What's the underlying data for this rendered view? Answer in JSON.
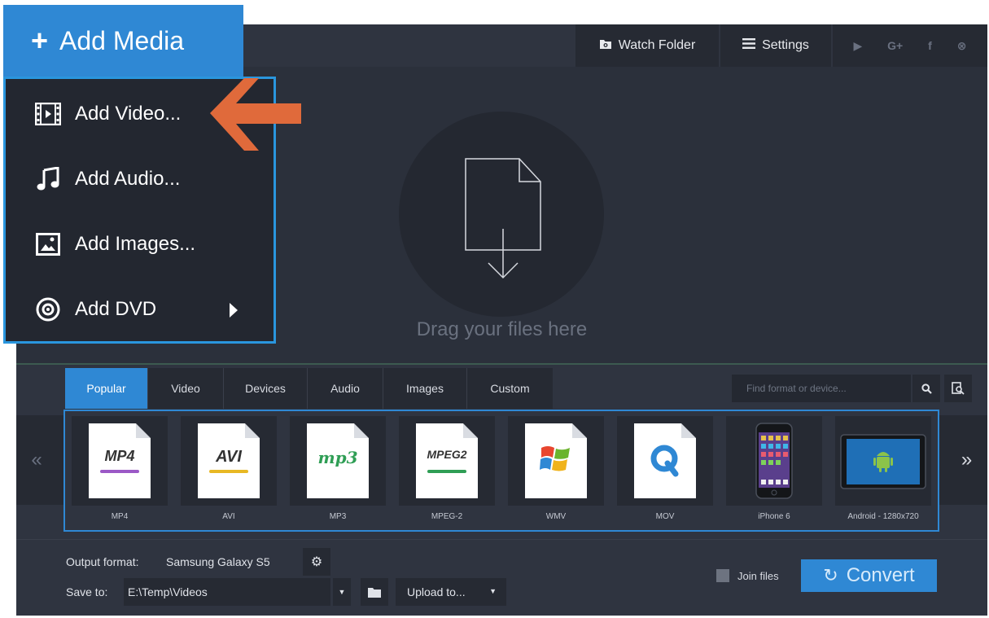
{
  "toolbar": {
    "add_media": "Add Media",
    "watch_folder": "Watch Folder",
    "settings": "Settings",
    "social": [
      "youtube-icon",
      "google-plus-icon",
      "facebook-icon",
      "vk-icon"
    ]
  },
  "add_menu": {
    "items": [
      {
        "label": "Add Video...",
        "icon": "film-icon"
      },
      {
        "label": "Add Audio...",
        "icon": "music-note-icon"
      },
      {
        "label": "Add Images...",
        "icon": "image-icon"
      },
      {
        "label": "Add DVD",
        "icon": "disc-icon"
      }
    ]
  },
  "drop_area": {
    "text": "Drag your files here"
  },
  "formats": {
    "tabs": [
      "Popular",
      "Video",
      "Devices",
      "Audio",
      "Images",
      "Custom"
    ],
    "active_tab": "Popular",
    "search_placeholder": "Find format or device...",
    "items": [
      {
        "label": "MP4",
        "badge": "MP4"
      },
      {
        "label": "AVI",
        "badge": "AVI"
      },
      {
        "label": "MP3",
        "badge": "mp3"
      },
      {
        "label": "MPEG-2",
        "badge": "MPEG2"
      },
      {
        "label": "WMV",
        "badge": "windows-logo-icon"
      },
      {
        "label": "MOV",
        "badge": "quicktime-icon"
      },
      {
        "label": "iPhone 6",
        "badge": "iphone-icon"
      },
      {
        "label": "Android - 1280x720",
        "badge": "android-tablet-icon"
      }
    ],
    "prev": "«",
    "next": "»"
  },
  "output": {
    "label": "Output format:",
    "value": "Samsung Galaxy S5",
    "save_label": "Save to:",
    "save_path": "E:\\Temp\\Videos",
    "upload": "Upload to...",
    "join_files": "Join files",
    "convert": "Convert"
  },
  "colors": {
    "accent": "#2f88d4",
    "arrow": "#e06a3b",
    "background": "#2f3440"
  }
}
